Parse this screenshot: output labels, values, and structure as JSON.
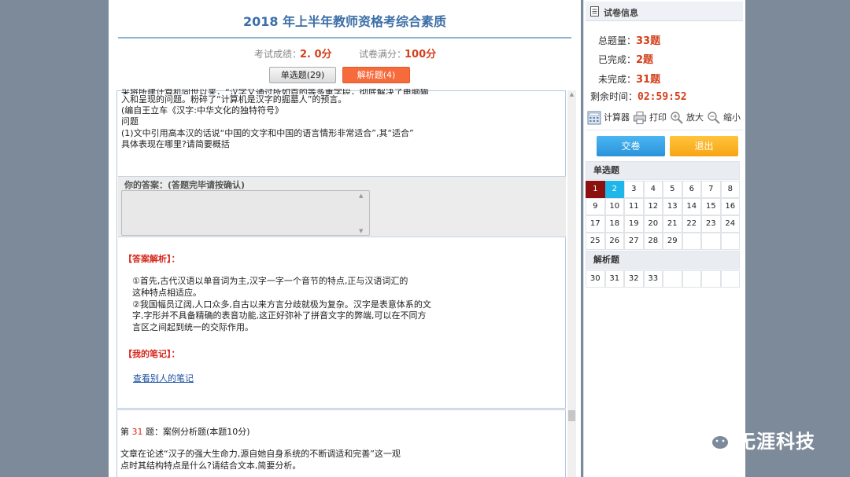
{
  "exam": {
    "title": "2018 年上半年教师资格考综合素质",
    "score_label": "考试成绩：",
    "score_value": "2. 0分",
    "full_label": "试卷满分：",
    "full_value": "100分"
  },
  "tabs": {
    "single": "单选题(29)",
    "analysis": "解析题(4)"
  },
  "question30": {
    "lines": [
      "采将所建计算机同世以来，“汉字又通过所如首的等多重字段，彻底解决了电脑输",
      "入和呈现的问题。粉碎了“计算机是汉字的掘墓人”的预言。",
      "(编自王立车《汉字:中华文化的独特符号》",
      "问题",
      "(1)文中引用高本汉的话说“中国的文字和中国的语言情形非常适合”,其“适合”",
      "具体表现在哪里?请简要概括"
    ]
  },
  "answer": {
    "label": "你的答案：(答题完毕请按确认)",
    "value": ""
  },
  "analysis": {
    "heading": "【答案解析】：",
    "lines": [
      "①首先,古代汉语以单音词为主,汉字一字一个音节的特点,正与汉语词汇的",
      "这种特点相适应。",
      "②我国幅员辽阔,人口众多,自古以来方言分歧就极为复杂。汉字是表意体系的文",
      "字,字形并不具备精确的表音功能,这正好弥补了拼音文字的弊端,可以在不同方",
      "言区之间起到统一的交际作用。"
    ]
  },
  "notes": {
    "heading": "【我的笔记】：",
    "link": "查看别人的笔记"
  },
  "question31": {
    "prefix": "第 ",
    "number": "31",
    "suffix": " 题：案例分析题(本题10分)",
    "lines": [
      "文章在论述“汉子的强大生命力,源自她自身系统的不断调适和完善”这一观",
      "点时其结构特点是什么?请结合文本,简要分析。"
    ]
  },
  "sidebar": {
    "info_title": "试卷信息",
    "total_label": "总题量：",
    "total_value": "33题",
    "done_label": "已完成：",
    "done_value": "2题",
    "undone_label": "未完成：",
    "undone_value": "31题",
    "time_label": "剩余时间：",
    "time_value": "02:59:52",
    "tools": {
      "calculator": "计算器",
      "print": "打印",
      "zoom_in": "放大",
      "zoom_out": "缩小"
    },
    "submit": "交卷",
    "exit": "退出",
    "single_head": "单选题",
    "analysis_head": "解析题",
    "single_numbers": [
      "1",
      "2",
      "3",
      "4",
      "5",
      "6",
      "7",
      "8",
      "9",
      "10",
      "11",
      "12",
      "13",
      "14",
      "15",
      "16",
      "17",
      "18",
      "19",
      "20",
      "21",
      "22",
      "23",
      "24",
      "25",
      "26",
      "27",
      "28",
      "29"
    ],
    "analysis_numbers": [
      "30",
      "31",
      "32",
      "33"
    ],
    "current_question": "1",
    "answered_question": "2"
  },
  "watermark": {
    "text": "无涯科技"
  },
  "colors": {
    "accent_red": "#d4401a",
    "tab_active": "#f66a3c",
    "submit_blue": "#2a93d9",
    "exit_orange": "#f7a413",
    "current_cell": "#8b1111",
    "answered_cell": "#1fb6ea"
  }
}
